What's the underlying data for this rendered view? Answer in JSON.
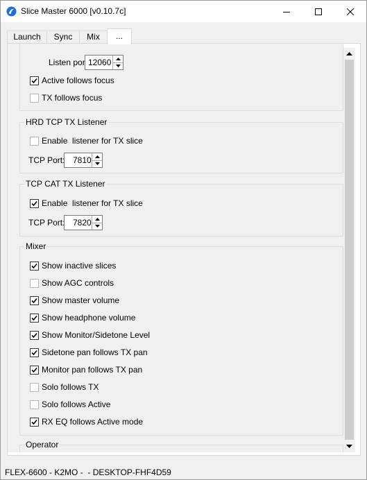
{
  "window": {
    "title": "Slice Master 6000 [v0.10.7c]"
  },
  "tabs": [
    {
      "label": "Launch",
      "active": false
    },
    {
      "label": "Sync",
      "active": false
    },
    {
      "label": "Mix",
      "active": false
    },
    {
      "label": "...",
      "active": true
    }
  ],
  "top_group": {
    "listen_port_label": "Listen port:",
    "listen_port_value": "12060",
    "checkboxes": [
      {
        "label": "Active follows focus",
        "checked": true
      },
      {
        "label": "TX follows focus",
        "checked": false
      }
    ]
  },
  "hrd_group": {
    "title": "HRD TCP TX Listener",
    "enable_label": "Enable  listener for TX slice",
    "enable_checked": false,
    "port_label": "TCP Port:",
    "port_value": "7810"
  },
  "tcpcat_group": {
    "title": "TCP CAT TX Listener",
    "enable_label": "Enable  listener for TX slice",
    "enable_checked": true,
    "port_label": "TCP Port:",
    "port_value": "7820"
  },
  "mixer_group": {
    "title": "Mixer",
    "checkboxes": [
      {
        "label": "Show inactive slices",
        "checked": true
      },
      {
        "label": "Show AGC controls",
        "checked": false
      },
      {
        "label": "Show master volume",
        "checked": true
      },
      {
        "label": "Show headphone volume",
        "checked": true
      },
      {
        "label": "Show Monitor/Sidetone Level",
        "checked": true
      },
      {
        "label": "Sidetone pan follows TX pan",
        "checked": true
      },
      {
        "label": "Monitor pan follows TX pan",
        "checked": true
      },
      {
        "label": "Solo follows TX",
        "checked": false
      },
      {
        "label": "Solo follows Active",
        "checked": false
      },
      {
        "label": "RX EQ follows Active mode",
        "checked": true
      }
    ]
  },
  "operator_group": {
    "title": "Operator"
  },
  "status_bar": {
    "text": "FLEX-6600 - K2MO -  - DESKTOP-FHF4D59"
  },
  "colors": {
    "tab_panel_bg": "#ffffff",
    "content_bg": "#f0f0f0",
    "scrollbar_thumb": "#cdcdcd"
  }
}
